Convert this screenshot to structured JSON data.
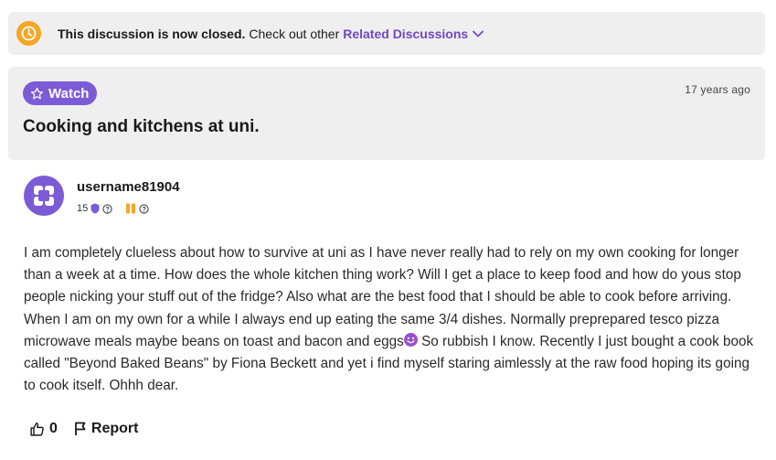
{
  "banner": {
    "strong": "This discussion is now closed.",
    "text": "Check out other",
    "link": "Related Discussions",
    "icon": "clock-icon",
    "icon_color": "#f5a623"
  },
  "thread": {
    "watch_label": "Watch",
    "time_ago": "17 years ago",
    "title": "Cooking and kitchens at uni."
  },
  "post": {
    "username": "username81904",
    "reputation": "15",
    "body": "I am completely clueless about how to survive at uni as I have never really had to rely on my own cooking for longer than a week at a time. How does the whole kitchen thing work? Will I get a place to keep food and how do yous stop people nicking your stuff out of the fridge? Also what are the best food that I should be able to cook before arriving. When I am on my own for a while I always end up eating the same 3/4 dishes. Normally preprepared tesco pizza microwave meals maybe beans on toast and bacon and eggs",
    "body_after_emoji": " So rubbish I know. Recently I just bought a cook book called \"Beyond Baked Beans\" by Fiona Beckett and yet i find myself staring aimlessly at the raw food hoping its going to cook itself. Ohhh dear.",
    "likes": "0",
    "report_label": "Report"
  },
  "colors": {
    "accent": "#7c5cd6",
    "link": "#7048c4",
    "panel": "#efefef"
  }
}
